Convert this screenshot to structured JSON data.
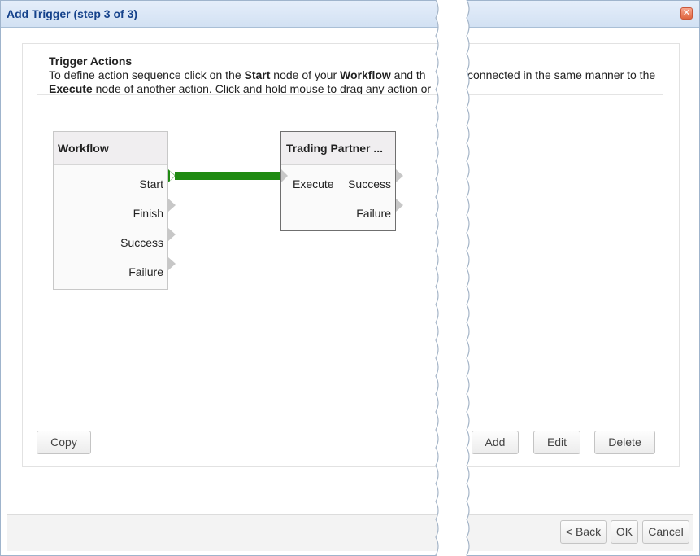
{
  "dialog": {
    "title": "Add Trigger (step 3 of 3)",
    "close_icon": "close-icon"
  },
  "section": {
    "title": "Trigger Actions",
    "line1": {
      "part1": "To define action sequence click on the ",
      "bold1": "Start",
      "part2": " node of your ",
      "bold2": "Workflow",
      "part3": " and th",
      "part4": "connected in the same manner to the"
    },
    "line2": {
      "bold1": "Execute",
      "part1": " node of another action. Click and hold mouse to drag any action or"
    }
  },
  "workflow_node": {
    "title": "Workflow",
    "ports": [
      "Start",
      "Finish",
      "Success",
      "Failure"
    ]
  },
  "action_node": {
    "title": "Trading Partner ...",
    "input_port": "Execute",
    "ports": [
      "Success",
      "Failure"
    ]
  },
  "colors": {
    "connector": "#1f8a12",
    "title_text": "#15428b"
  },
  "buttons": {
    "copy": "Copy",
    "add": "Add",
    "edit": "Edit",
    "delete": "Delete"
  },
  "footer": {
    "back": "< Back",
    "ok": "OK",
    "cancel": "Cancel"
  }
}
